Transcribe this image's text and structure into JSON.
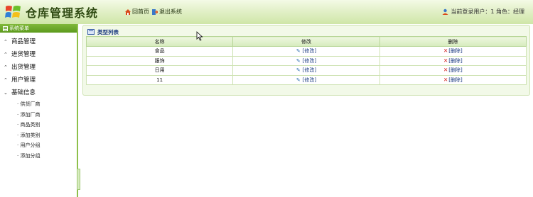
{
  "header": {
    "title": "仓库管理系统",
    "nav": {
      "home": "回首页",
      "logout": "退出系统"
    },
    "user_info": "当前登录用户：1 角色：经理"
  },
  "sidebar": {
    "heading": "系统菜单",
    "items": [
      {
        "label": "商品管理",
        "expanded": false
      },
      {
        "label": "进货管理",
        "expanded": false
      },
      {
        "label": "出货管理",
        "expanded": false
      },
      {
        "label": "用户管理",
        "expanded": false
      },
      {
        "label": "基础信息",
        "expanded": true
      }
    ],
    "subitems": [
      "供货厂商",
      "添加厂商",
      "商品类别",
      "添加类别",
      "用户分组",
      "添加分组"
    ]
  },
  "panel": {
    "title": "类型列表",
    "columns": [
      "名称",
      "修改",
      "删除"
    ],
    "rows": [
      {
        "name": "食品",
        "edit": "[修改]",
        "delete": "[删除]"
      },
      {
        "name": "服饰",
        "edit": "[修改]",
        "delete": "[删除]"
      },
      {
        "name": "日用",
        "edit": "[修改]",
        "delete": "[删除]"
      },
      {
        "name": "11",
        "edit": "[修改]",
        "delete": "[删除]"
      }
    ]
  },
  "colors": {
    "accent": "#7fb83a",
    "header_bg": "#e2f0c8",
    "link": "#1a3a80",
    "delete": "#d42020"
  }
}
